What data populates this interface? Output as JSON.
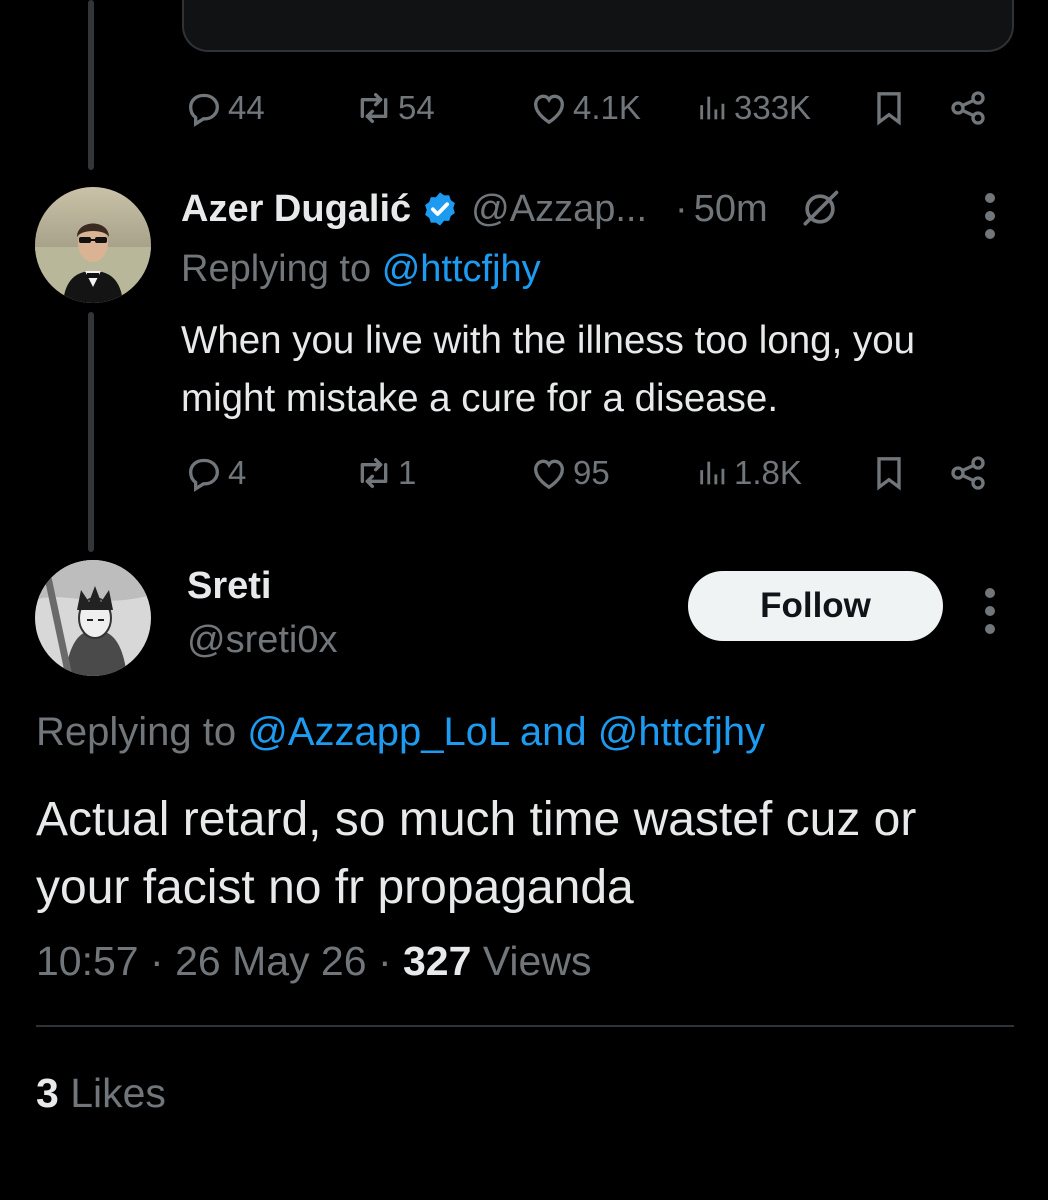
{
  "parent_tweet": {
    "stats": {
      "replies": "44",
      "reposts": "54",
      "likes": "4.1K",
      "views": "333K"
    }
  },
  "reply_tweet": {
    "author": {
      "name": "Azer Dugalić",
      "handle": "@Azzap...",
      "verified": true
    },
    "time": "50m",
    "dot": "·",
    "replying_prefix": "Replying to",
    "replying_to": "@httcfjhy",
    "text": "When you live with the illness too long, you might mistake a cure for a disease.",
    "stats": {
      "replies": "4",
      "reposts": "1",
      "likes": "95",
      "views": "1.8K"
    }
  },
  "main_tweet": {
    "author": {
      "name": "Sreti",
      "handle": "@sreti0x"
    },
    "follow_label": "Follow",
    "replying_prefix": "Replying to",
    "replying_to_1": "@Azzapp_LoL",
    "replying_and": "and",
    "replying_to_2": "@httcfjhy",
    "text": "Actual retard, so much time wastef cuz or your facist no fr propaganda",
    "time": "10:57",
    "date": "26 May 26",
    "views_count": "327",
    "views_label": "Views",
    "sep": "·",
    "likes_count": "3",
    "likes_label": "Likes"
  },
  "icons": [
    "reply-icon",
    "repost-icon",
    "like-icon",
    "views-icon",
    "bookmark-icon",
    "share-icon",
    "verified-badge-icon",
    "grok-icon",
    "more-icon"
  ],
  "colors": {
    "background": "#000000",
    "text": "#e7e9ea",
    "muted": "#71767b",
    "accent": "#1d9bf0",
    "divider": "#2f3336"
  }
}
